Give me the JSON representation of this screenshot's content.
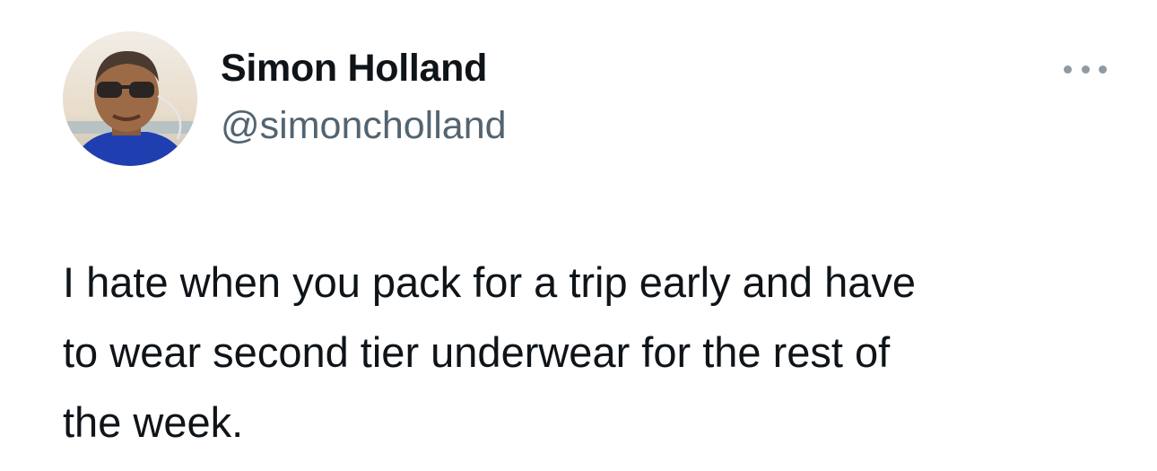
{
  "author": {
    "display_name": "Simon Holland",
    "handle": "@simoncholland"
  },
  "menu": {
    "icon": "more-horizontal-icon"
  },
  "tweet": {
    "text_lines": [
      "I hate when you pack for a trip early and have",
      "to wear second tier underwear for the rest of",
      "the week."
    ]
  },
  "colors": {
    "text_primary": "#0f1419",
    "text_secondary": "#536471",
    "background": "#ffffff"
  }
}
